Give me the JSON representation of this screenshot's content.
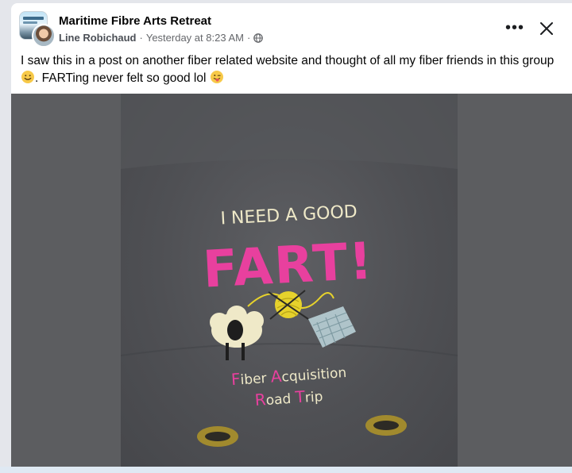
{
  "post": {
    "group_name": "Maritime Fibre Arts Retreat",
    "author": "Line Robichaud",
    "separator": "·",
    "timestamp": "Yesterday at 8:23 AM",
    "audience_icon": "globe-icon",
    "body_part1": "I saw this in a post on another fiber related website and thought of all my fiber friends in this group",
    "body_part2": ". FARTing never felt so good lol",
    "emoji1": "smiling-face-emoji",
    "emoji2": "winking-tongue-emoji"
  },
  "photo": {
    "line1": "I NEED A GOOD",
    "line2": "FART!",
    "line3a_initial": "F",
    "line3a_rest": "iber ",
    "line3b_initial": "A",
    "line3b_rest": "cquisition",
    "line4a_initial": "R",
    "line4a_rest": "oad ",
    "line4b_initial": "T",
    "line4b_rest": "rip"
  },
  "colors": {
    "pink": "#e8409e",
    "cream": "#efe9c8",
    "yellow": "#e6d22c",
    "grey_bag": "#505155",
    "backdrop": "#5c5d60"
  }
}
